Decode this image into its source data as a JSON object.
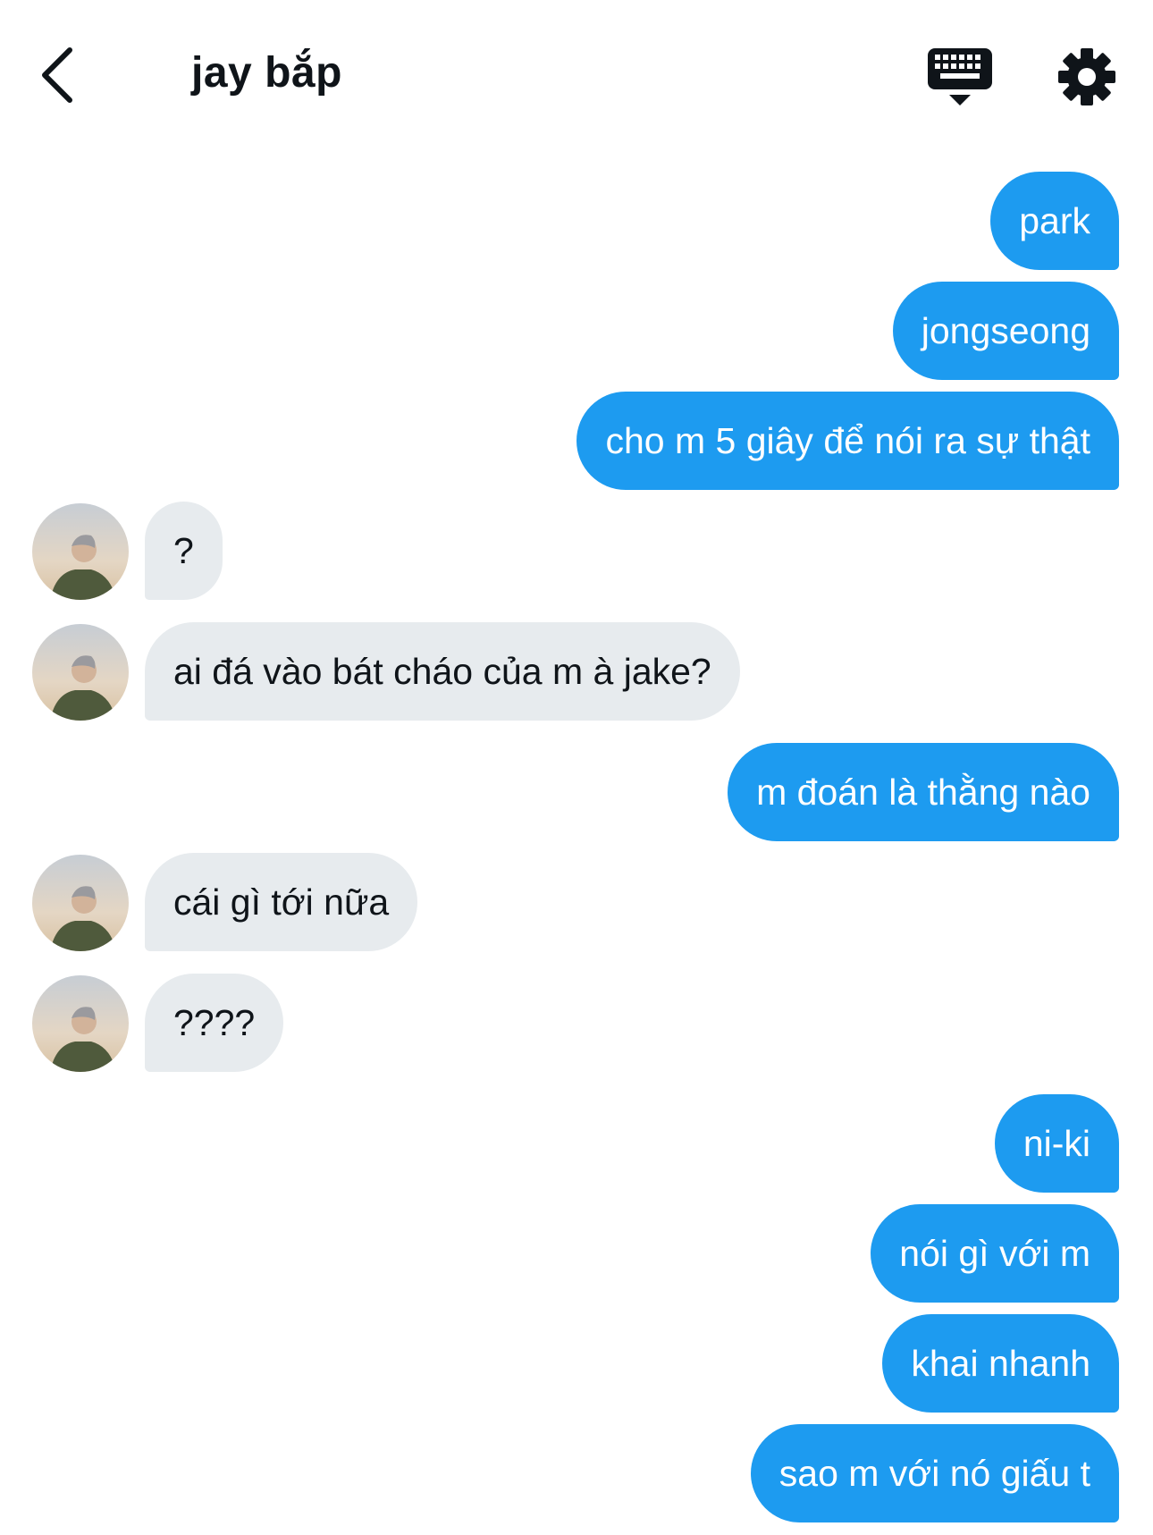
{
  "header": {
    "title": "jay bắp",
    "back_icon": "chevron-left-icon",
    "keyboard_icon": "keyboard-icon",
    "settings_icon": "gear-icon"
  },
  "colors": {
    "sent_bubble": "#1d9bf0",
    "received_bubble": "#e7ebee"
  },
  "messages": [
    {
      "side": "sent",
      "text": "park"
    },
    {
      "side": "sent",
      "text": "jongseong"
    },
    {
      "side": "sent",
      "text": "cho m 5 giây để nói ra sự thật"
    },
    {
      "side": "received",
      "text": "?"
    },
    {
      "side": "received",
      "text": "ai đá vào bát cháo của m à jake?"
    },
    {
      "side": "sent",
      "text": "m đoán là thằng nào"
    },
    {
      "side": "received",
      "text": "cái gì tới nữa"
    },
    {
      "side": "received",
      "text": "????"
    },
    {
      "side": "sent",
      "text": "ni-ki"
    },
    {
      "side": "sent",
      "text": "nói gì với m"
    },
    {
      "side": "sent",
      "text": "khai nhanh"
    },
    {
      "side": "sent",
      "text": "sao m với nó giấu t"
    }
  ]
}
